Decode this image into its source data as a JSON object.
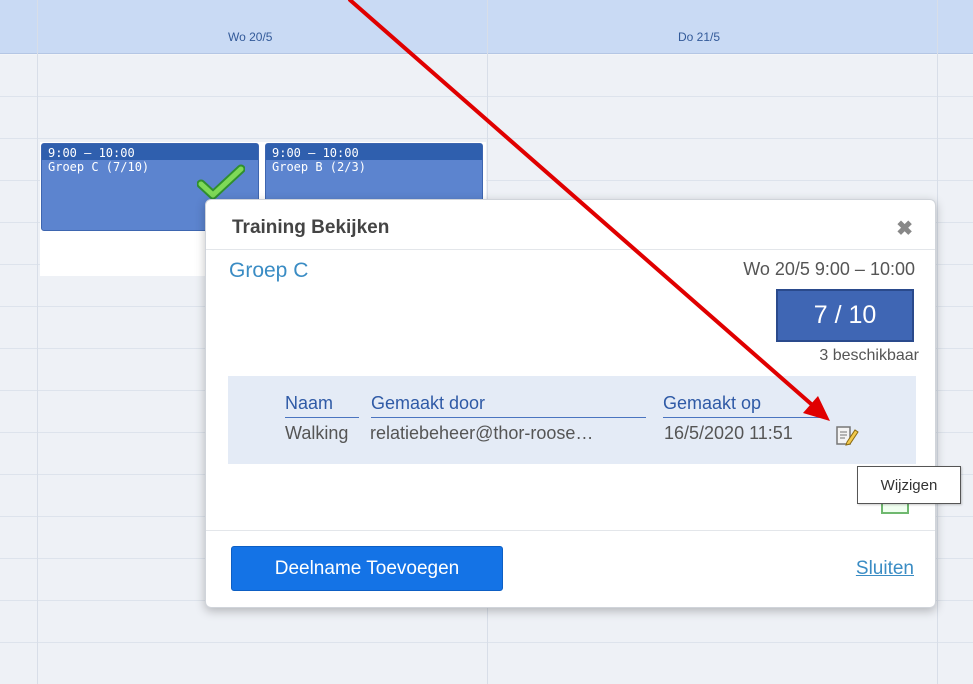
{
  "calendar": {
    "days": [
      {
        "label": "Wo 20/5"
      },
      {
        "label": "Do 21/5"
      }
    ],
    "events": [
      {
        "time": "9:00 – 10:00",
        "title": "Groep C (7/10)"
      },
      {
        "time": "9:00 – 10:00",
        "title": "Groep B (2/3)"
      }
    ]
  },
  "dialog": {
    "title": "Training Bekijken",
    "close_glyph": "✖",
    "group_name": "Groep C",
    "date_time": "Wo 20/5  9:00 – 10:00",
    "count": "7 / 10",
    "available": "3 beschikbaar",
    "table": {
      "headers": [
        "Naam",
        "Gemaakt door",
        "Gemaakt op"
      ],
      "rows": [
        {
          "naam": "Walking",
          "gemaakt_door": "relatiebeheer@thor-roose…",
          "gemaakt_op": "16/5/2020 11:51"
        }
      ]
    },
    "add_button": "Deelname Toevoegen",
    "close_link": "Sluiten"
  },
  "tooltip": {
    "text": "Wijzigen"
  },
  "colors": {
    "header_bg": "#c9daf4",
    "event_bg": "#5c84cf",
    "count_bg": "#3f66b4",
    "button_bg": "#1473e6",
    "link": "#3a8cc4",
    "arrow": "#e00000"
  }
}
